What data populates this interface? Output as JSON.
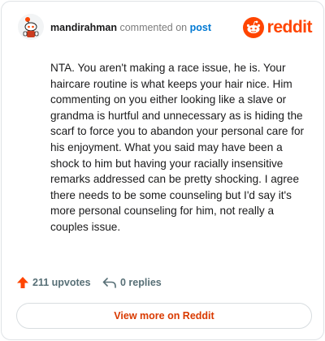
{
  "header": {
    "username": "mandirahman",
    "action_text": "commented on",
    "post_link": "post",
    "logo_text": "reddit",
    "avatar_icon": "snoo-avatar-icon",
    "logo_icon": "reddit-snoo-icon"
  },
  "comment": {
    "text": "NTA. You aren't making a race issue, he is. Your haircare routine is what keeps your hair nice. Him commenting on you either looking like a slave or grandma is hurtful and unnecessary as is hiding the scarf to force you to abandon your personal care for his enjoyment. What you said may have been a shock to him but having your racially insensitive remarks addressed can be pretty shocking. I agree there needs to be some counseling but I'd say it's more personal counseling for him, not really a couples issue."
  },
  "actions": {
    "upvotes_label": "211 upvotes",
    "replies_label": "0 replies",
    "upvote_icon": "upvote-arrow-icon",
    "reply_icon": "reply-arrow-icon"
  },
  "footer": {
    "view_more_label": "View more on Reddit"
  },
  "colors": {
    "brand": "#ff4500",
    "link": "#0079d3",
    "button_text": "#d93a00",
    "muted": "#576f76"
  }
}
